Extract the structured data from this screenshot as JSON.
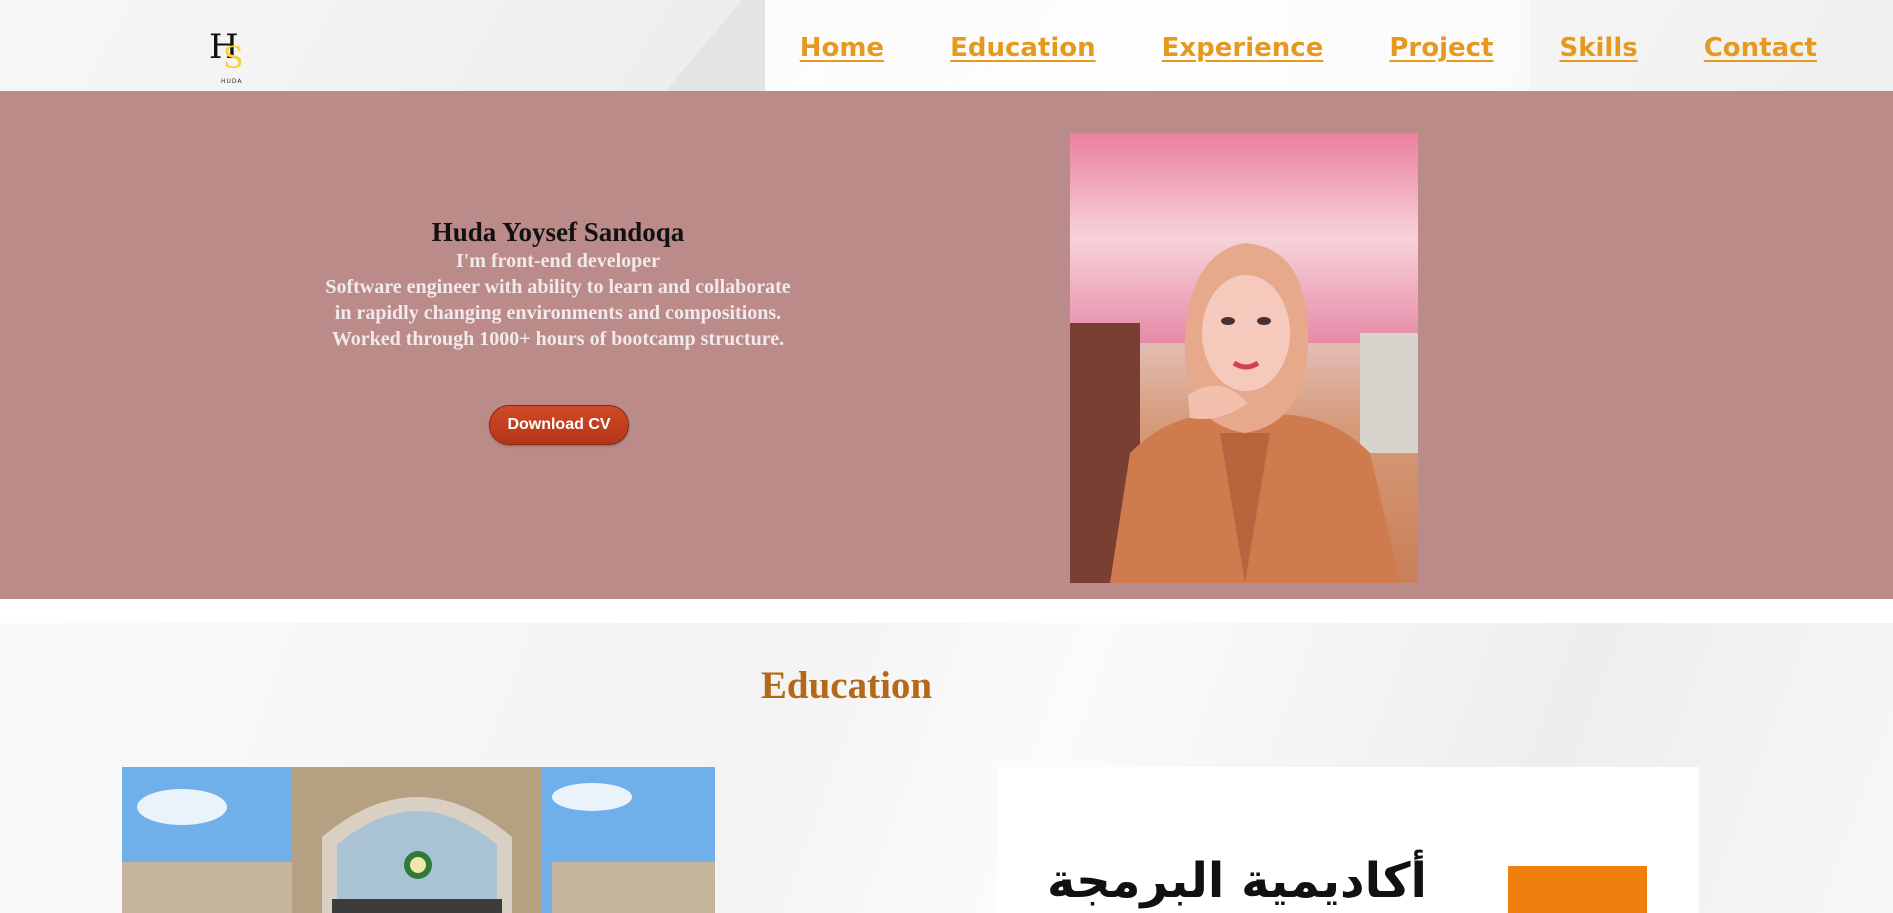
{
  "logo": {
    "mark_primary": "H",
    "mark_secondary": "S",
    "caption": "HUDA"
  },
  "nav": {
    "items": [
      "Home",
      "Education",
      "Experience",
      "Project",
      "Skills",
      "Contact"
    ]
  },
  "hero": {
    "name": "Huda Yoysef Sandoqa",
    "lines": [
      "I'm front-end developer",
      "Software engineer with ability to learn and collaborate",
      "in rapidly changing environments and compositions.",
      "Worked through 1000+ hours of bootcamp structure."
    ],
    "cv_button": "Download CV"
  },
  "education": {
    "title": "Education",
    "university_image_alt": "Al-Balqa Applied University gate",
    "academy_text": "أكاديمية البرمجة"
  },
  "colors": {
    "nav_link": "#e59a1f",
    "hero_bg": "#bb8b8a",
    "cv_button": "#c2401d",
    "section_title": "#b4691a",
    "academy_orange": "#f07f0d"
  }
}
